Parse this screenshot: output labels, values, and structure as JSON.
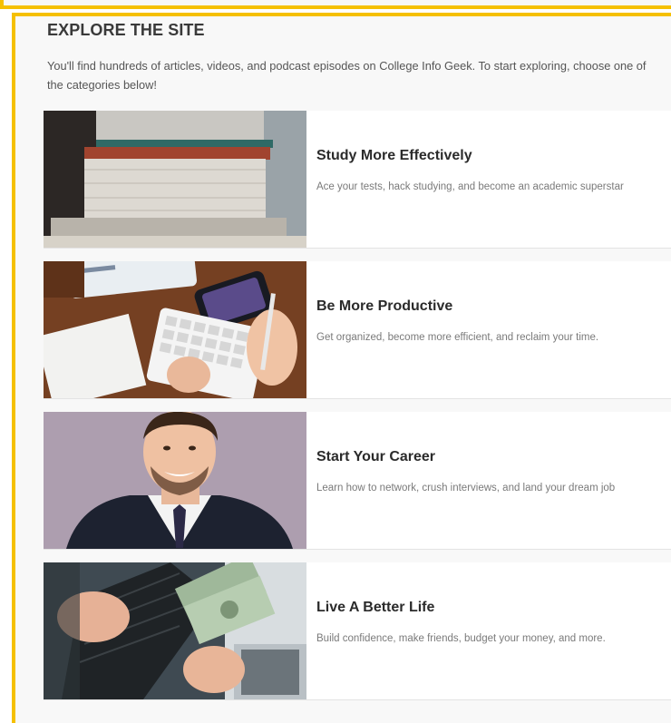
{
  "explore": {
    "title": "EXPLORE THE SITE",
    "intro": "You'll find hundreds of articles, videos, and podcast episodes on College Info Geek. To start exploring, choose one of the categories below!"
  },
  "accent_color": "#f5c000",
  "categories": [
    {
      "title": "Study More Effectively",
      "description": "Ace your tests, hack studying, and become an academic superstar",
      "image_icon": "stacked-books-photo"
    },
    {
      "title": "Be More Productive",
      "description": "Get organized, become more efficient, and reclaim your time.",
      "image_icon": "desk-keyboard-phone-photo"
    },
    {
      "title": "Start Your Career",
      "description": "Learn how to network, crush interviews, and land your dream job",
      "image_icon": "businessman-portrait-photo"
    },
    {
      "title": "Live A Better Life",
      "description": "Build confidence, make friends, budget your money, and more.",
      "image_icon": "wallet-money-photo"
    }
  ]
}
